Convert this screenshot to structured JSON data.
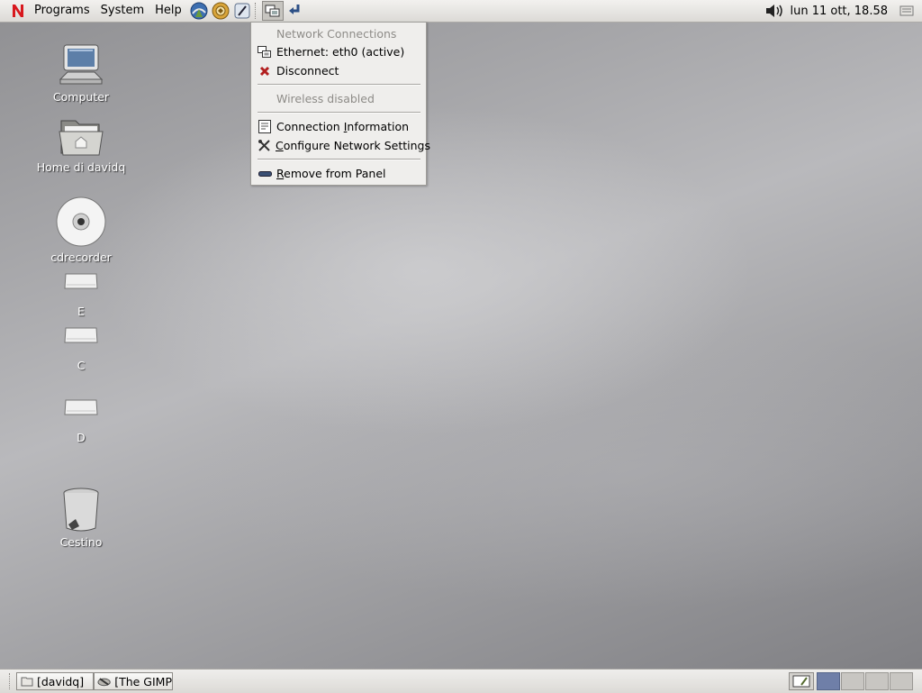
{
  "top_panel": {
    "menus": [
      "Programs",
      "System",
      "Help"
    ],
    "launchers": [
      "web-browser-icon",
      "mail-icon",
      "text-editor-icon"
    ],
    "clock": "lun 11 ott, 18.58"
  },
  "network_menu": {
    "header": "Network Connections",
    "ethernet": "Ethernet: eth0 (active)",
    "disconnect": "Disconnect",
    "wireless": "Wireless disabled",
    "connection_info": "Connection Information",
    "connection_info_mnemonic": "I",
    "configure": "Configure Network Settings",
    "configure_mnemonic": "C",
    "remove": "Remove from Panel",
    "remove_mnemonic": "R"
  },
  "desktop_icons": [
    {
      "label": "Computer",
      "icon": "computer-icon"
    },
    {
      "label": "Home di davidq",
      "icon": "home-folder-icon"
    },
    {
      "label": "cdrecorder",
      "icon": "cd-drive-icon"
    },
    {
      "label": "E",
      "icon": "drive-icon"
    },
    {
      "label": "C",
      "icon": "drive-icon"
    },
    {
      "label": "D",
      "icon": "drive-icon"
    },
    {
      "label": "Cestino",
      "icon": "trash-icon"
    }
  ],
  "taskbar": {
    "tasks": [
      {
        "label": "[davidq]",
        "icon": "folder-icon"
      },
      {
        "label": "[The GIMP",
        "icon": "gimp-icon"
      }
    ],
    "workspaces": 4,
    "active_workspace": 1
  }
}
